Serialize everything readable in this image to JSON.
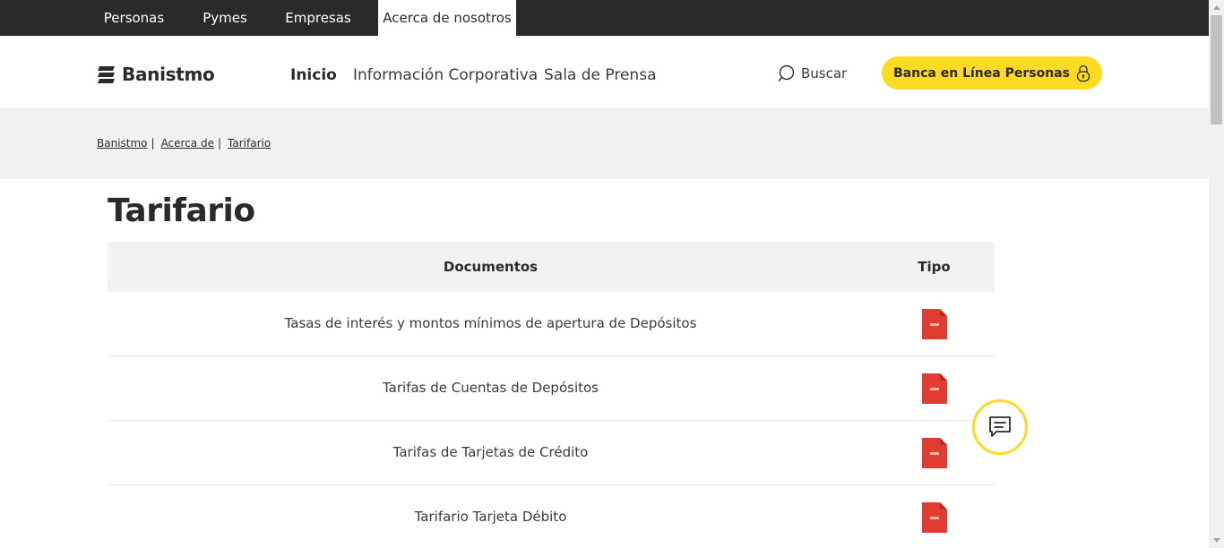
{
  "top_tabs": [
    {
      "label": "Personas"
    },
    {
      "label": "Pymes"
    },
    {
      "label": "Empresas"
    },
    {
      "label": "Acerca de nosotros",
      "active": true
    }
  ],
  "header": {
    "logo_text": "Banistmo",
    "nav": [
      {
        "label": "Inicio",
        "active": true
      },
      {
        "label": "Información Corporativa"
      },
      {
        "label": "Sala de Prensa"
      }
    ],
    "search_label": "Buscar",
    "cta_label": "Banca en Línea Personas"
  },
  "breadcrumb": [
    "Banistmo",
    "Acerca de",
    "Tarifario"
  ],
  "page_title": "Tarifario",
  "table": {
    "headers": [
      "Documentos",
      "Tipo"
    ],
    "rows": [
      {
        "document": "Tasas de interés y montos mínimos de apertura de Depósitos",
        "type_icon": "pdf-icon"
      },
      {
        "document": "Tarifas de Cuentas de Depósitos",
        "type_icon": "pdf-icon"
      },
      {
        "document": "Tarifas de Tarjetas de Crédito",
        "type_icon": "pdf-icon"
      },
      {
        "document": "Tarifario Tarjeta Débito",
        "type_icon": "pdf-icon"
      }
    ]
  },
  "icons": {
    "search": "search-icon",
    "lock": "lock-icon",
    "chat": "chat-icon",
    "pdf": "pdf-icon"
  },
  "colors": {
    "brand_yellow": "#fdda24",
    "topbar": "#2c2a29",
    "pdf_red": "#e03c31",
    "band_gray": "#f2f2f2"
  }
}
